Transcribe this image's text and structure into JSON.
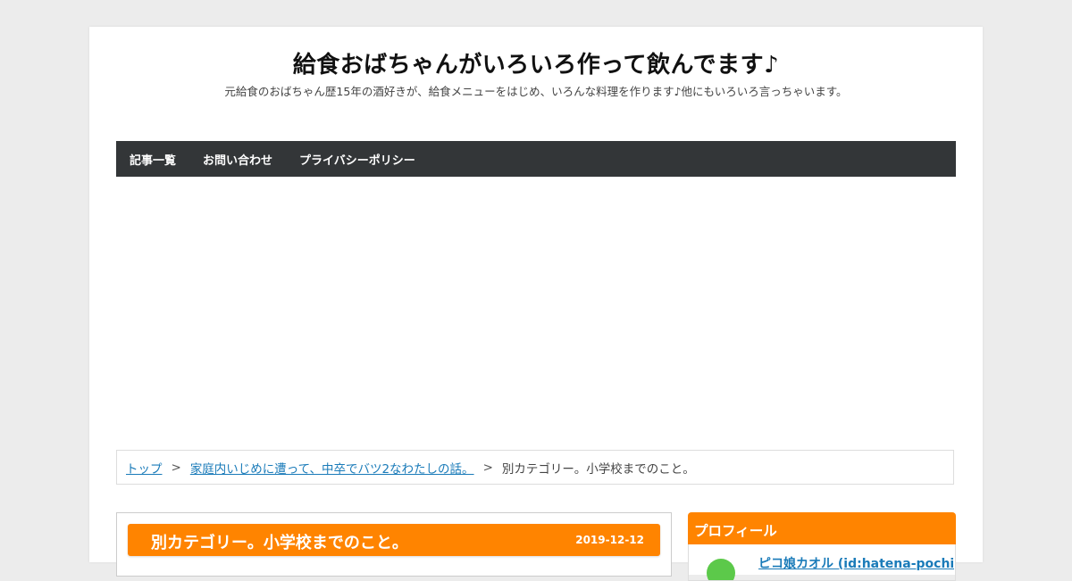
{
  "header": {
    "site_title": "給食おばちゃんがいろいろ作って飲んでます♪",
    "site_description": "元給食のおばちゃん歴15年の酒好きが、給食メニューをはじめ、いろんな料理を作ります♪他にもいろいろ言っちゃいます。"
  },
  "nav": {
    "items": [
      {
        "label": "記事一覧"
      },
      {
        "label": "お問い合わせ"
      },
      {
        "label": "プライバシーポリシー"
      }
    ]
  },
  "breadcrumb": {
    "top": "トップ",
    "separator": ">",
    "category": "家庭内いじめに遭って、中卒でバツ2なわたしの話。",
    "current": "別カテゴリー。小学校までのこと。"
  },
  "article": {
    "title": "別カテゴリー。小学校までのこと。",
    "date": "2019-12-12"
  },
  "sidebar": {
    "profile": {
      "title": "プロフィール",
      "name": "ピコ娘カオル (id:hatena-pochi)"
    }
  },
  "colors": {
    "accent": "#ff8400",
    "nav_bg": "#333638",
    "link": "#1a7bb9",
    "background": "#ececec"
  }
}
